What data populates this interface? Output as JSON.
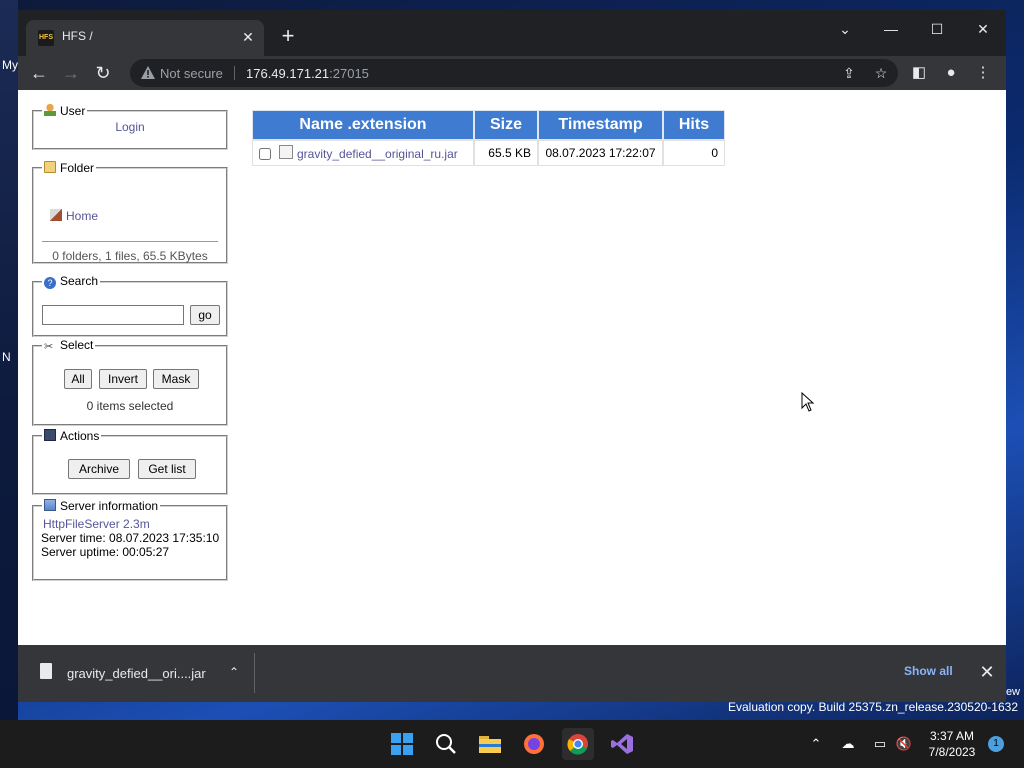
{
  "browser": {
    "tab_title": "HFS /",
    "tab_favicon_text": "HFS",
    "security_label": "Not secure",
    "url_host": "176.49.171.21",
    "url_port": ":27015"
  },
  "sidebar": {
    "user": {
      "legend": "User",
      "login_label": "Login"
    },
    "folder": {
      "legend": "Folder",
      "home_label": "Home",
      "stats": "0 folders, 1 files, 65.5 KBytes"
    },
    "search": {
      "legend": "Search",
      "query": "",
      "go_label": "go"
    },
    "select": {
      "legend": "Select",
      "all_label": "All",
      "invert_label": "Invert",
      "mask_label": "Mask",
      "status": "0 items selected"
    },
    "actions": {
      "legend": "Actions",
      "archive_label": "Archive",
      "getlist_label": "Get list"
    },
    "server": {
      "legend": "Server information",
      "version_link": "HttpFileServer 2.3m",
      "time_line": "Server time: 08.07.2023 17:35:10",
      "uptime_line": "Server uptime: 00:05:27"
    }
  },
  "filelist": {
    "columns": [
      "Name .extension",
      "Size",
      "Timestamp",
      "Hits"
    ],
    "rows": [
      {
        "name": "gravity_defied__original_ru.jar",
        "size": "65.5 KB",
        "timestamp": "08.07.2023 17:22:07",
        "hits": "0"
      }
    ]
  },
  "downloads": {
    "item_name": "gravity_defied__ori....jar",
    "show_all_label": "Show all"
  },
  "desktop": {
    "left_labels": [
      "My",
      "N"
    ],
    "right_fragment": "ew",
    "evaluation_text": "Evaluation copy. Build 25375.zn_release.230520-1632"
  },
  "taskbar": {
    "time": "3:37 AM",
    "date": "7/8/2023",
    "notification_count": "1",
    "apps": [
      "windows-start-icon",
      "search-icon",
      "file-explorer-icon",
      "firefox-icon",
      "chrome-icon",
      "visual-studio-icon"
    ]
  },
  "colors": {
    "table_header": "#3f7bd1",
    "link": "#555599",
    "chrome_dark": "#202124",
    "chrome_toolbar": "#35363a"
  }
}
